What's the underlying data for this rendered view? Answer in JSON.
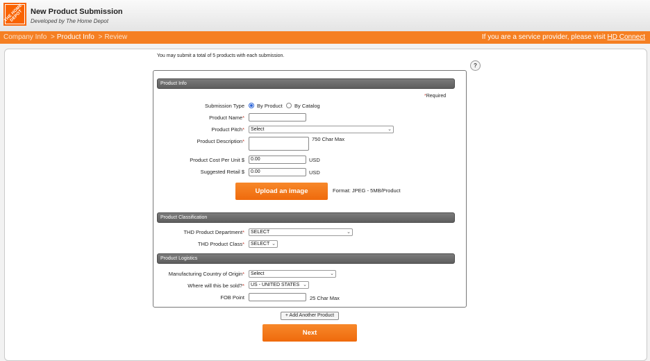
{
  "header": {
    "logo_text": "THE HOME DEPOT",
    "title": "New Product Submission",
    "subtitle": "Developed by The Home Depot"
  },
  "nav": {
    "crumbs": [
      "Company Info",
      "Product Info",
      "Review"
    ],
    "active_crumb": "Product Info",
    "separator": ">",
    "provider_text": "If you are a service provider, please visit ",
    "provider_link": "HD Connect"
  },
  "form": {
    "intro": "You may submit a total of 5 products with each submission.",
    "help": "?",
    "required_note": "Required",
    "sections": {
      "product_info": "Product Info",
      "product_classification": "Product Classification",
      "product_logistics": "Product Logistics"
    },
    "submission_type": {
      "label": "Submission Type",
      "options": [
        "By Product",
        "By Catalog"
      ],
      "selected": "By Product"
    },
    "product_name": {
      "label": "Product Name",
      "value": ""
    },
    "product_pitch": {
      "label": "Product Pitch",
      "value": "Select"
    },
    "product_description": {
      "label": "Product Description",
      "hint": "750 Char Max",
      "value": ""
    },
    "cost_per_unit": {
      "label": "Product Cost Per Unit $",
      "value": "0.00",
      "unit": "USD"
    },
    "suggested_retail": {
      "label": "Suggested Retail $",
      "value": "0.00",
      "unit": "USD"
    },
    "upload": {
      "label": "Upload an image",
      "format": "Format: JPEG - 5MB/Product"
    },
    "department": {
      "label": "THD Product Department",
      "value": "SELECT"
    },
    "product_class": {
      "label": "THD Product Class",
      "value": "SELECT"
    },
    "country_of_origin": {
      "label": "Manufacturing Country of Origin",
      "value": "Select"
    },
    "sold_where": {
      "label": "Where will this be sold?",
      "value": "US - UNITED STATES"
    },
    "fob_point": {
      "label": "FOB Point",
      "value": "",
      "hint": "25 Char Max"
    },
    "add_product": "+ Add Another Product",
    "next": "Next"
  },
  "colors": {
    "brand_orange": "#f96302",
    "nav_orange": "#f57f22",
    "section_gray": "#6b6b6b",
    "radio_blue": "#2b64d8"
  }
}
